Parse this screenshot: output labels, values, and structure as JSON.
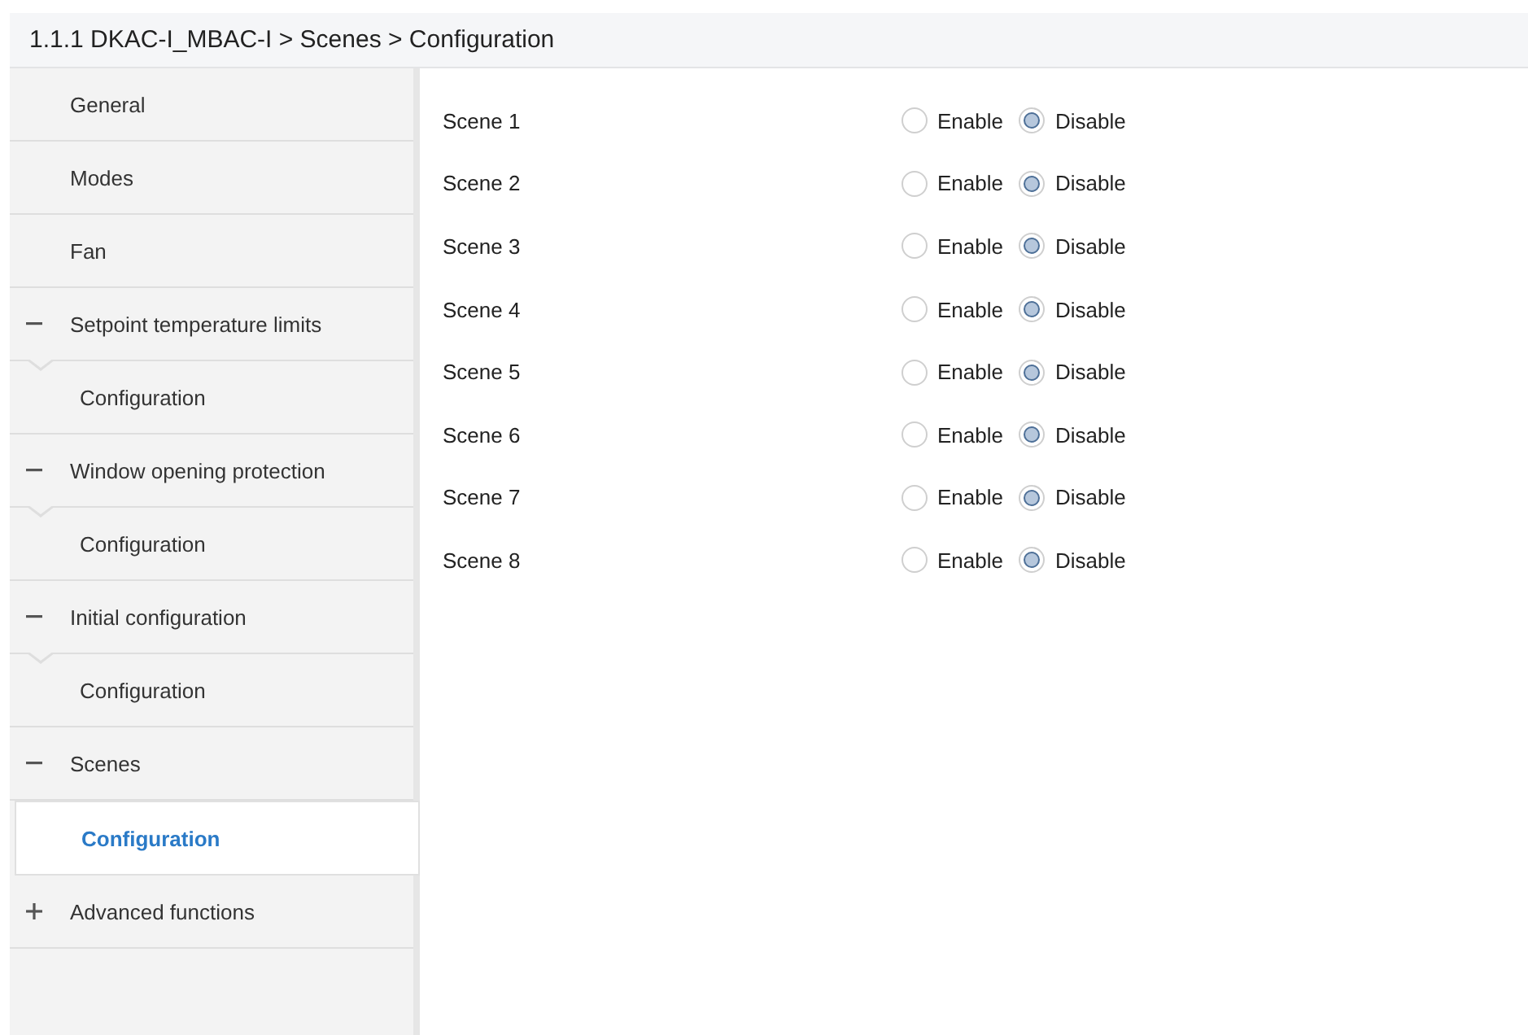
{
  "breadcrumb": "1.1.1 DKAC-I_MBAC-I > Scenes > Configuration",
  "sidebar": {
    "items": [
      {
        "label": "General",
        "selected": false
      },
      {
        "label": "Modes",
        "selected": false
      },
      {
        "label": "Fan",
        "selected": false
      },
      {
        "label": "Setpoint temperature limits",
        "selected": false,
        "expanded": true,
        "children": [
          {
            "label": "Configuration",
            "selected": false
          }
        ]
      },
      {
        "label": "Window opening protection",
        "selected": false,
        "expanded": true,
        "children": [
          {
            "label": "Configuration",
            "selected": false
          }
        ]
      },
      {
        "label": "Initial configuration",
        "selected": false,
        "expanded": true,
        "children": [
          {
            "label": "Configuration",
            "selected": false
          }
        ]
      },
      {
        "label": "Scenes",
        "selected": false,
        "expanded": true,
        "children": [
          {
            "label": "Configuration",
            "selected": true
          }
        ]
      },
      {
        "label": "Advanced functions",
        "selected": false,
        "expanded": false
      }
    ]
  },
  "scenes": [
    {
      "label": "Scene 1",
      "options": [
        {
          "label": "Enable",
          "selected": false
        },
        {
          "label": "Disable",
          "selected": true
        }
      ]
    },
    {
      "label": "Scene 2",
      "options": [
        {
          "label": "Enable",
          "selected": false
        },
        {
          "label": "Disable",
          "selected": true
        }
      ]
    },
    {
      "label": "Scene 3",
      "options": [
        {
          "label": "Enable",
          "selected": false
        },
        {
          "label": "Disable",
          "selected": true
        }
      ]
    },
    {
      "label": "Scene 4",
      "options": [
        {
          "label": "Enable",
          "selected": false
        },
        {
          "label": "Disable",
          "selected": true
        }
      ]
    },
    {
      "label": "Scene 5",
      "options": [
        {
          "label": "Enable",
          "selected": false
        },
        {
          "label": "Disable",
          "selected": true
        }
      ]
    },
    {
      "label": "Scene 6",
      "options": [
        {
          "label": "Enable",
          "selected": false
        },
        {
          "label": "Disable",
          "selected": true
        }
      ]
    },
    {
      "label": "Scene 7",
      "options": [
        {
          "label": "Enable",
          "selected": false
        },
        {
          "label": "Disable",
          "selected": true
        }
      ]
    },
    {
      "label": "Scene 8",
      "options": [
        {
          "label": "Enable",
          "selected": false
        },
        {
          "label": "Disable",
          "selected": true
        }
      ]
    }
  ]
}
